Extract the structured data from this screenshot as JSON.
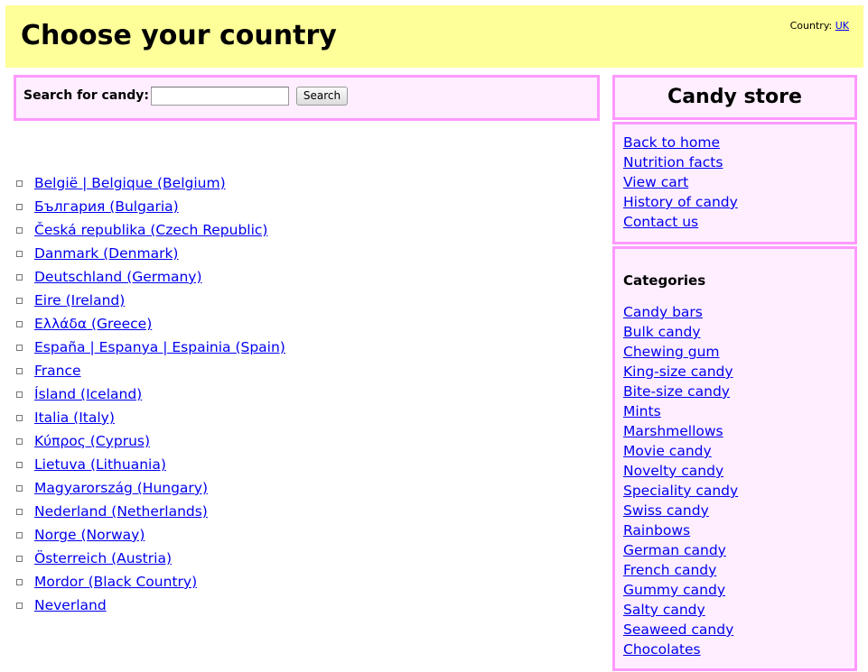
{
  "header": {
    "title": "Choose your country",
    "country_label": "Country:",
    "country_value": "UK"
  },
  "search": {
    "label": "Search for candy:",
    "input_value": "",
    "button_label": "Search"
  },
  "countries": [
    "België | Belgique (Belgium)",
    "България  (Bulgaria)",
    "Česká republika (Czech Republic)",
    "Danmark (Denmark)",
    "Deutschland (Germany)",
    "Eire (Ireland)",
    "Ελλάδα (Greece)",
    "España | Espanya | Espainia (Spain)",
    "France",
    "Ísland (Iceland)",
    "Italia (Italy)",
    "Κύπρος (Cyprus)",
    "Lietuva (Lithuania)",
    "Magyarország (Hungary)",
    "Nederland (Netherlands)",
    "Norge (Norway)",
    "Österreich (Austria)",
    "Mordor (Black Country)",
    "Neverland "
  ],
  "sidebar": {
    "title": "Candy store",
    "nav_links": [
      "Back to home",
      "Nutrition facts",
      "View cart",
      "History of candy",
      "Contact us"
    ],
    "categories_heading": "Categories",
    "categories": [
      "Candy bars",
      "Bulk candy",
      "Chewing gum",
      "King-size candy",
      "Bite-size candy",
      "Mints",
      "Marshmellows",
      "Movie candy",
      "Novelty candy",
      "Speciality candy",
      "Swiss candy",
      "Rainbows",
      "German candy",
      "French candy",
      "Gummy candy",
      "Salty candy",
      "Seaweed candy",
      "Chocolates"
    ]
  },
  "colors": {
    "header_background": "#ffff99",
    "panel_background": "#ffeeff",
    "panel_border": "#ff99ff",
    "link": "#0000ee"
  }
}
